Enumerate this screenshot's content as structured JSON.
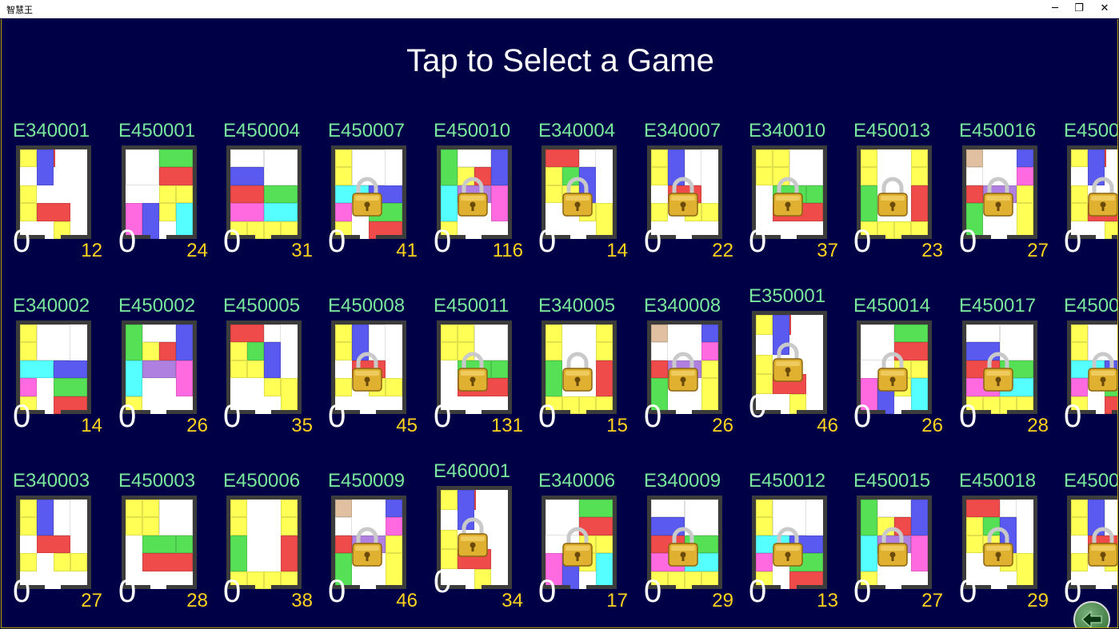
{
  "window": {
    "title": "智慧王",
    "minimize_icon": "─",
    "restore_icon": "❐",
    "close_icon": "✕"
  },
  "heading": "Tap to Select a Game",
  "colors": {
    "background": "#000046",
    "code_text": "#79e89c",
    "moves_text": "#ffd21e",
    "score_text": "#ffffff"
  },
  "rows": [
    {
      "games": [
        {
          "code": "E340001",
          "score": "0",
          "moves": "12",
          "locked": false
        },
        {
          "code": "E450001",
          "score": "0",
          "moves": "24",
          "locked": false
        },
        {
          "code": "E450004",
          "score": "0",
          "moves": "31",
          "locked": false
        },
        {
          "code": "E450007",
          "score": "0",
          "moves": "41",
          "locked": true
        },
        {
          "code": "E450010",
          "score": "0",
          "moves": "116",
          "locked": true
        },
        {
          "code": "E340004",
          "score": "0",
          "moves": "14",
          "locked": true
        },
        {
          "code": "E340007",
          "score": "0",
          "moves": "22",
          "locked": true
        },
        {
          "code": "E340010",
          "score": "0",
          "moves": "37",
          "locked": true
        },
        {
          "code": "E450013",
          "score": "0",
          "moves": "23",
          "locked": true
        },
        {
          "code": "E450016",
          "score": "0",
          "moves": "27",
          "locked": true
        },
        {
          "code": "E4500",
          "score": "0",
          "moves": "",
          "locked": true
        }
      ]
    },
    {
      "games": [
        {
          "code": "E340002",
          "score": "0",
          "moves": "14",
          "locked": false
        },
        {
          "code": "E450002",
          "score": "0",
          "moves": "26",
          "locked": false
        },
        {
          "code": "E450005",
          "score": "0",
          "moves": "35",
          "locked": false
        },
        {
          "code": "E450008",
          "score": "0",
          "moves": "45",
          "locked": true
        },
        {
          "code": "E450011",
          "score": "0",
          "moves": "131",
          "locked": true
        },
        {
          "code": "E340005",
          "score": "0",
          "moves": "15",
          "locked": true
        },
        {
          "code": "E340008",
          "score": "0",
          "moves": "26",
          "locked": true
        },
        {
          "code": "E350001",
          "score": "0",
          "moves": "46",
          "locked": true
        },
        {
          "code": "E450014",
          "score": "0",
          "moves": "26",
          "locked": true
        },
        {
          "code": "E450017",
          "score": "0",
          "moves": "28",
          "locked": true
        },
        {
          "code": "E4500",
          "score": "0",
          "moves": "",
          "locked": true
        }
      ]
    },
    {
      "games": [
        {
          "code": "E340003",
          "score": "0",
          "moves": "27",
          "locked": false
        },
        {
          "code": "E450003",
          "score": "0",
          "moves": "28",
          "locked": false
        },
        {
          "code": "E450006",
          "score": "0",
          "moves": "38",
          "locked": false
        },
        {
          "code": "E450009",
          "score": "0",
          "moves": "46",
          "locked": true
        },
        {
          "code": "E460001",
          "score": "0",
          "moves": "34",
          "locked": true
        },
        {
          "code": "E340006",
          "score": "0",
          "moves": "17",
          "locked": true
        },
        {
          "code": "E340009",
          "score": "0",
          "moves": "29",
          "locked": true
        },
        {
          "code": "E450012",
          "score": "0",
          "moves": "13",
          "locked": true
        },
        {
          "code": "E450015",
          "score": "0",
          "moves": "27",
          "locked": true
        },
        {
          "code": "E450018",
          "score": "0",
          "moves": "29",
          "locked": true
        },
        {
          "code": "E4500",
          "score": "0",
          "moves": "",
          "locked": true
        }
      ]
    }
  ],
  "back_button": {
    "icon": "back-arrow-icon"
  }
}
